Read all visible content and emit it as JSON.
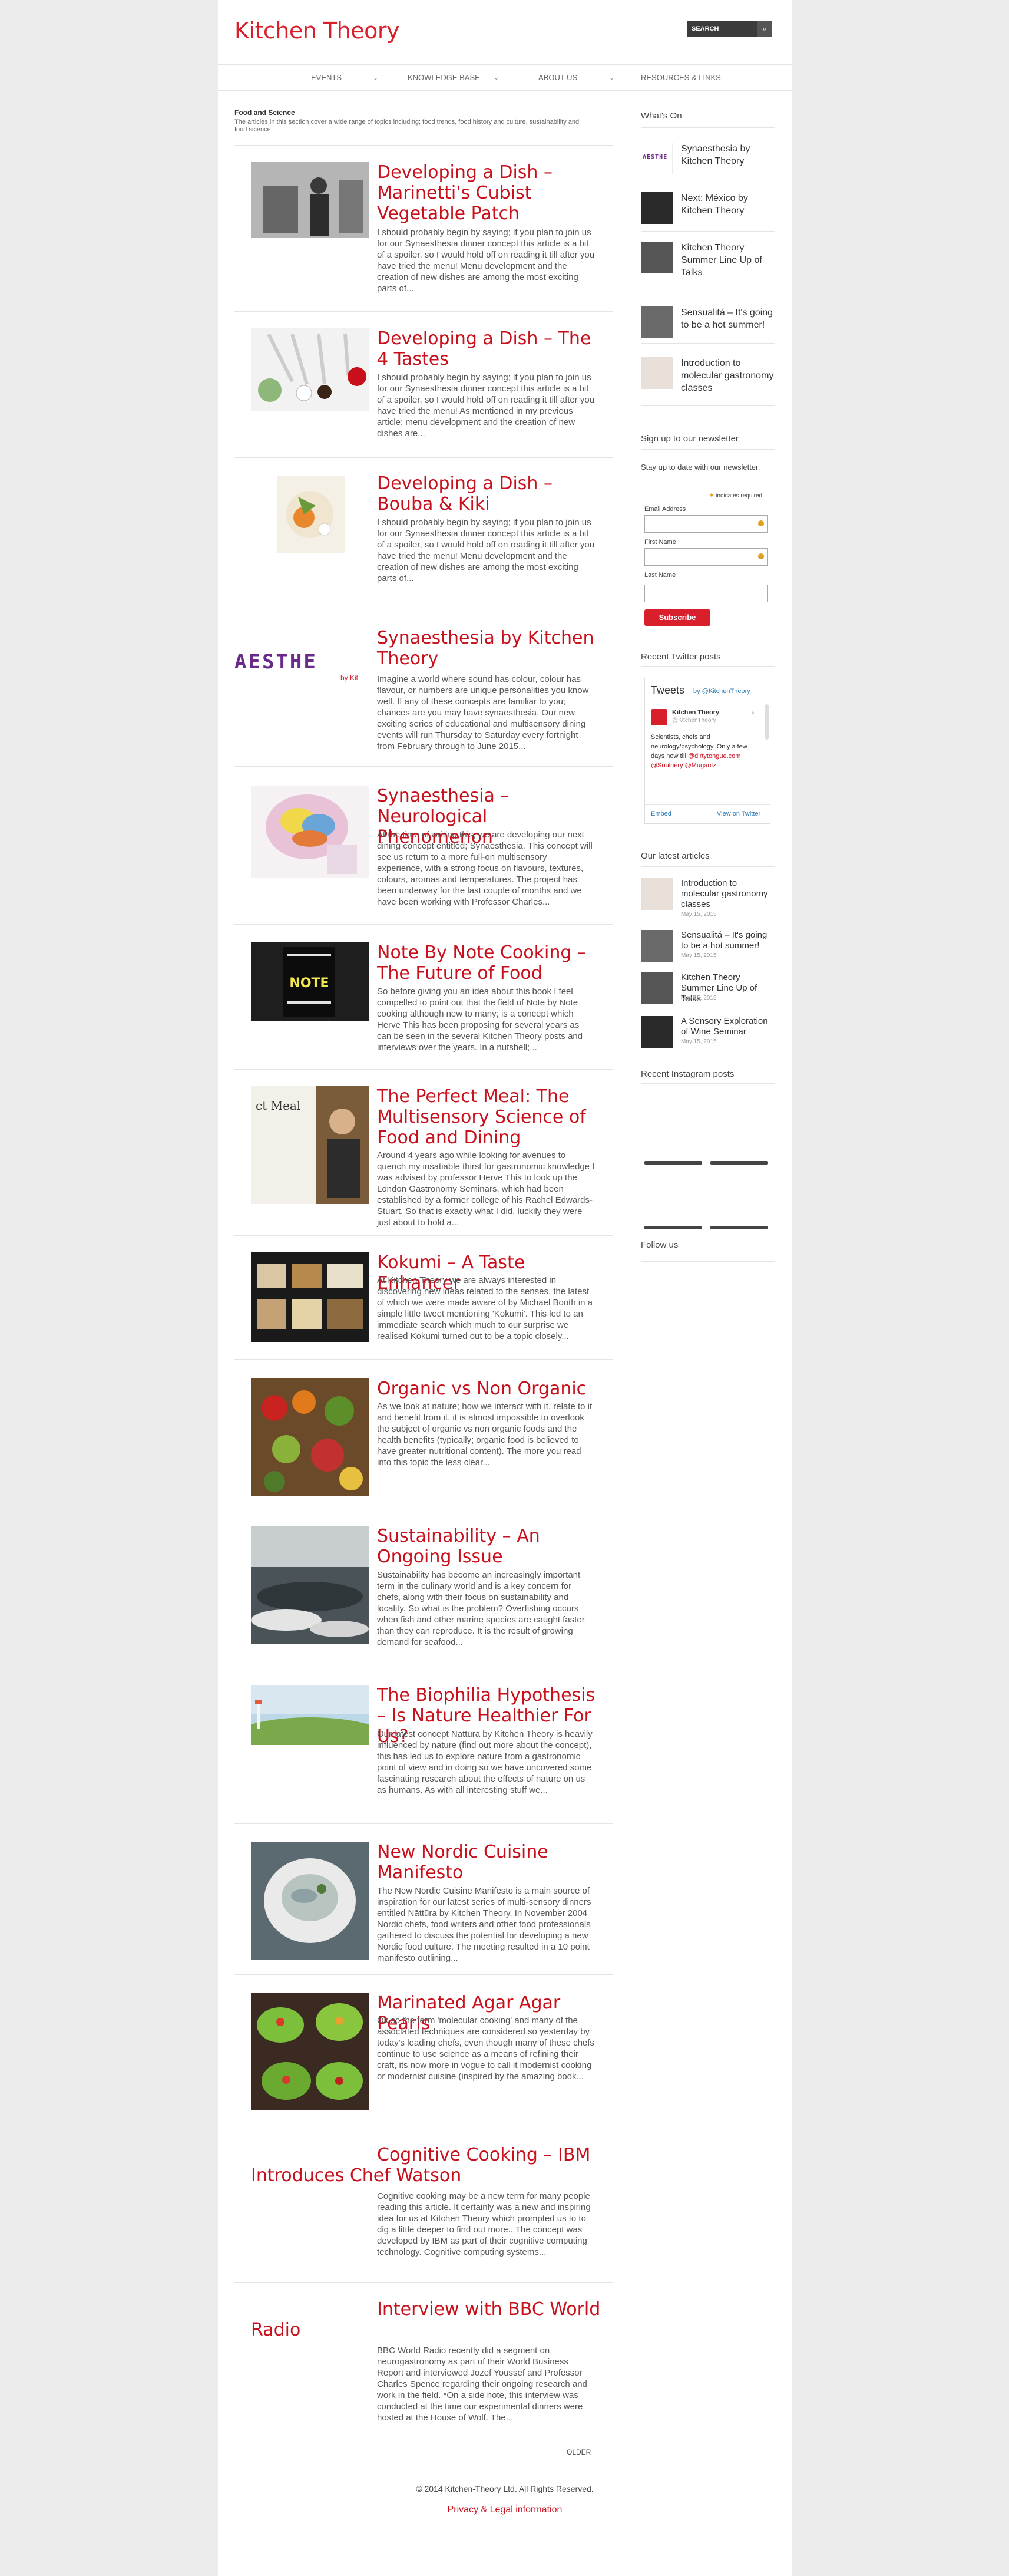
{
  "header": {
    "logo": "Kitchen Theory",
    "search_placeholder": "SEARCH"
  },
  "nav": {
    "items": [
      {
        "label": "EVENTS"
      },
      {
        "label": "KNOWLEDGE BASE"
      },
      {
        "label": "ABOUT US"
      },
      {
        "label": "RESOURCES & LINKS"
      }
    ]
  },
  "category": {
    "title": "Food and Science",
    "description": "The articles in this section cover a wide range of topics including; food trends, food history and culture, sustainability and food science"
  },
  "posts": [
    {
      "title": "Developing a Dish – Marinetti's Cubist Vegetable Patch",
      "excerpt": "I should probably begin by saying; if you plan to join us for our Synaesthesia dinner concept this article is a bit of a spoiler, so I would hold off on reading it till after you have tried the menu! Menu development and the creation of new dishes are among the most exciting parts of..."
    },
    {
      "title": "Developing a Dish – The 4 Tastes",
      "excerpt": "I should probably begin by saying; if you plan to join us for our Synaesthesia dinner concept this article is a bit of a spoiler, so I would hold off on reading it till after you have tried the menu! As mentioned in my previous article; menu development and the creation of new dishes are..."
    },
    {
      "title": "Developing a Dish – Bouba & Kiki",
      "excerpt": "I should probably begin by saying; if you plan to join us for our Synaesthesia dinner concept this article is a bit of a spoiler, so I would hold off on reading it till after you have tried the menu! Menu development and the creation of new dishes are among the most exciting parts of..."
    },
    {
      "title": "Synaesthesia by Kitchen Theory",
      "excerpt": "Imagine a world where sound has colour, colour has flavour, or numbers are unique personalities you know well. If any of these concepts are familiar to you; chances are you may have synaesthesia. Our new exciting series of educational and multisensory dining events will run Thursday to Saturday every fortnight from February through to June 2015...",
      "thumb_text": "AESTHE",
      "thumb_sub": "by Kit"
    },
    {
      "title": "Synaesthesia – Neurological Phenomenon",
      "excerpt": "At the time of writing this, we are developing our next dining concept entitled; Synaesthesia. This concept will see us return to a more full-on multisensory experience, with a strong focus on flavours, textures, colours, aromas and temperatures. The project has been underway for the last couple of months and we have been working with Professor Charles..."
    },
    {
      "title": "Note By Note Cooking – The Future of Food",
      "excerpt": "So before giving you an idea about this book I feel compelled to point out that the field of Note by Note cooking although new to many; is a concept which Herve This has been proposing for several years as can be seen in the several Kitchen Theory posts and interviews over the years. In a nutshell;...",
      "thumb_text": "NOTE"
    },
    {
      "title": "The Perfect Meal: The Multisensory Science of Food and Dining",
      "excerpt": "Around 4 years ago while looking for avenues to quench my insatiable thirst for gastronomic knowledge I was advised by professor Herve This to look up the London Gastronomy Seminars, which had been established by a former college of his Rachel Edwards-Stuart. So that is exactly what I did, luckily they were just about to hold a...",
      "thumb_text": "ct Meal"
    },
    {
      "title": "Kokumi – A Taste Enhancer",
      "excerpt": "At Kitchen Theory we are always interested in discovering new ideas related to the senses, the latest of which we were made aware of by Michael Booth in a simple little tweet mentioning 'Kokumi'. This led to an immediate search which much to our surprise we realised Kokumi turned out to be a topic closely..."
    },
    {
      "title": "Organic vs Non Organic",
      "excerpt": "As we look at nature; how we interact with it, relate to it and benefit from it, it is almost impossible to overlook the subject of organic vs non organic foods and the health benefits (typically; organic food is believed to have greater nutritional content). The more you read into this topic the less clear..."
    },
    {
      "title": "Sustainability – An Ongoing Issue",
      "excerpt": "Sustainability has become an increasingly important term in the culinary world and is a key concern for chefs, along with their focus on sustainability and locality. So what is the problem? Overfishing occurs when fish and other marine species are caught faster than they can reproduce. It is the result of growing demand for seafood..."
    },
    {
      "title": "The Biophilia Hypothesis – Is Nature Healthier For Us?",
      "excerpt": "Our latest concept Nāttūra by Kitchen Theory is heavily influenced by nature (find out more about the concept), this has led us to explore nature from a gastronomic point of view and in doing so we have uncovered some fascinating research about the effects of nature on us as humans. As with all interesting stuff we..."
    },
    {
      "title": "New Nordic Cuisine Manifesto",
      "excerpt": "The New Nordic Cuisine Manifesto is a main source of inspiration for our latest series of multi-sensory dinners entitled Nāttūra by Kitchen Theory. In November 2004 Nordic chefs, food writers and other food professionals gathered to discuss the potential for developing a new Nordic food culture. The meeting resulted in a 10 point manifesto outlining..."
    },
    {
      "title": "Marinated Agar Agar Pearls",
      "excerpt": "Ok so the term 'molecular cooking' and many of the associated techniques are considered so yesterday by today's leading chefs, even though many of these chefs continue to use science as a means of refining their craft, its now more in vogue to call it modernist cooking or modernist cuisine (inspired by the amazing book..."
    },
    {
      "title": "Cognitive Cooking – IBM Introduces Chef Watson",
      "excerpt": "Cognitive cooking may be a new term for many people reading this article. It certainly was a new and inspiring idea for us at Kitchen Theory which prompted us to to dig a little deeper to find out more.. The concept was developed by IBM as part of their cognitive computing technology. Cognitive computing systems..."
    },
    {
      "title": "Interview with BBC World Radio",
      "excerpt": "BBC World Radio recently did a segment on neurogastronomy as part of their World Business Report and interviewed Jozef Youssef and Professor Charles Spence regarding their ongoing research and work in the field. *On a side note, this interview was conducted at the time our experimental dinners were hosted at the House of Wolf. The..."
    }
  ],
  "pagination": {
    "older": "OLDER"
  },
  "sidebar": {
    "whats_on_title": "What's On",
    "whats_on": [
      {
        "label": "Synaesthesia by Kitchen Theory",
        "thumb_text": "AESTHE"
      },
      {
        "label": "Next: México by Kitchen Theory"
      },
      {
        "label": "Kitchen Theory Summer Line Up of Talks"
      },
      {
        "label": "Sensualitá – It's going to be a hot summer!"
      },
      {
        "label": "Introduction to molecular gastronomy classes"
      }
    ],
    "newsletter": {
      "title": "Sign up to our newsletter",
      "intro": "Stay up to date with our newsletter.",
      "required_note": "indicates required",
      "email_label": "Email Address",
      "first_name_label": "First Name",
      "last_name_label": "Last Name",
      "subscribe_label": "Subscribe"
    },
    "twitter": {
      "title": "Recent Twitter posts",
      "widget_heading": "Tweets",
      "widget_by": "by @KitchenTheory",
      "account_name": "Kitchen Theory",
      "account_handle": "@KitchenTheory",
      "tweet_text": "Scientists, chefs and neurology/psychology. Only a few days now till",
      "tweet_link": "@dirtytongue.com",
      "tweet_mentions": "@Soulnery @Mugaritz",
      "embed_label": "Embed",
      "view_label": "View on Twitter"
    },
    "latest_title": "Our latest articles",
    "latest": [
      {
        "title": "Introduction to molecular gastronomy classes",
        "date": "May 15, 2015"
      },
      {
        "title": "Sensualitá – It's going to be a hot summer!",
        "date": "May 15, 2015"
      },
      {
        "title": "Kitchen Theory Summer Line Up of Talks",
        "date": "May 15, 2015"
      },
      {
        "title": "A Sensory Exploration of Wine Seminar",
        "date": "May 15, 2015"
      }
    ],
    "instagram_title": "Recent Instagram posts",
    "follow_title": "Follow us"
  },
  "footer": {
    "copyright": "© 2014 Kitchen-Theory Ltd. All Rights Reserved.",
    "privacy": "Privacy & Legal information"
  },
  "colors": {
    "accent": "#d91f2b",
    "title_red": "#c8101c",
    "dark": "#3b3b3b"
  }
}
